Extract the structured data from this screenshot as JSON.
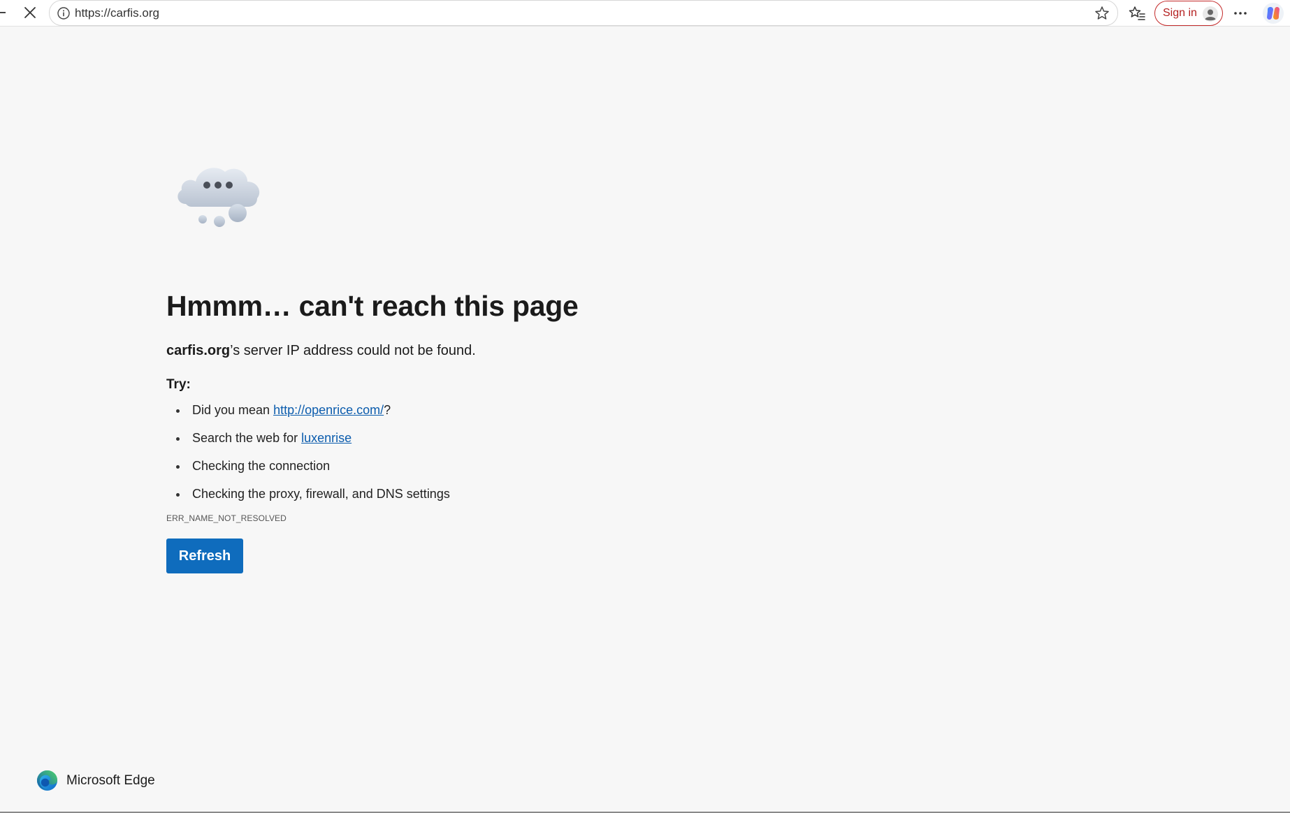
{
  "browser": {
    "url": "https://carfis.org",
    "sign_in_label": "Sign in",
    "icons": {
      "stop": "close-icon",
      "site_info": "info-icon",
      "favorite": "star-icon",
      "favorites_bar": "favorites-icon",
      "profile": "avatar-icon",
      "more": "more-icon",
      "copilot": "copilot-icon"
    },
    "colors": {
      "sign_in_border": "#c42b2b",
      "toolbar_bg": "#ffffff"
    }
  },
  "error_page": {
    "title": "Hmmm… can't reach this page",
    "host": "carfis.org",
    "host_suffix": "’s server IP address could not be found.",
    "try_label": "Try:",
    "suggestion_1_prefix": "Did you mean ",
    "suggestion_1_link": "http://openrice.com/",
    "suggestion_1_suffix": "?",
    "suggestion_2_prefix": "Search the web for ",
    "suggestion_2_link": "luxenrise",
    "suggestion_3": "Checking the connection",
    "suggestion_4": "Checking the proxy, firewall, and DNS settings",
    "error_code": "ERR_NAME_NOT_RESOLVED",
    "refresh_label": "Refresh",
    "colors": {
      "link": "#0b5cad",
      "button": "#0f6cbd",
      "background": "#f7f7f7"
    }
  },
  "footer": {
    "brand_name": "Microsoft Edge",
    "logo_icon": "edge-logo-icon"
  }
}
